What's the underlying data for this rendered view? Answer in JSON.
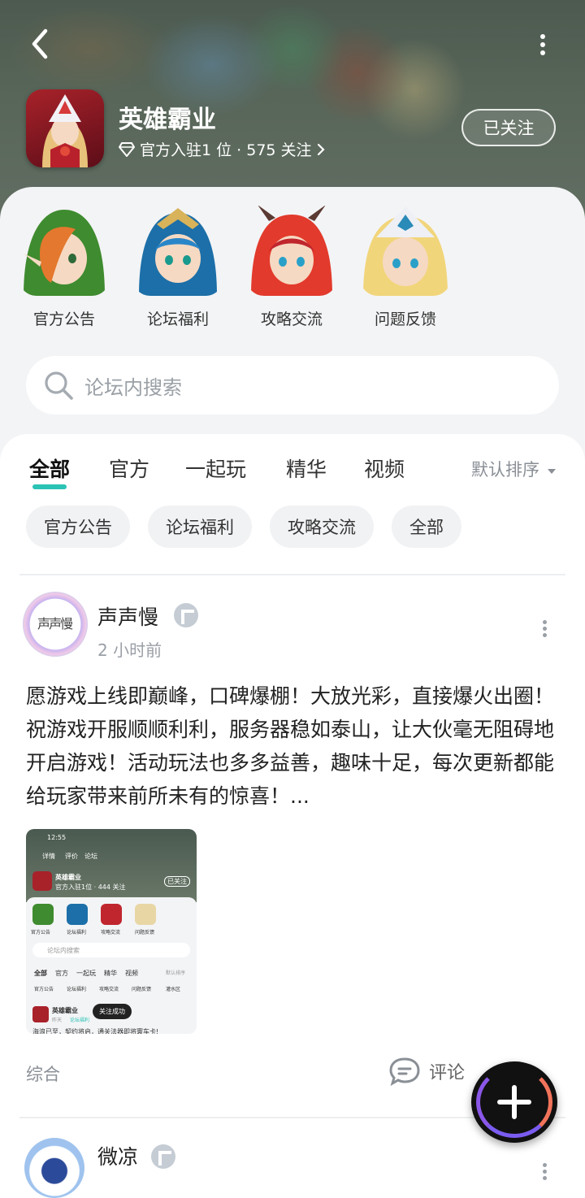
{
  "header": {
    "game_title": "英雄霸业",
    "meta_text": "官方入驻1 位 · 575 关注",
    "follow_label": "已关注"
  },
  "categories": [
    {
      "label": "官方公告",
      "color": "#3f8b2f",
      "hair": "#e4782e"
    },
    {
      "label": "论坛福利",
      "color": "#1c6fa8",
      "hair": "#2a86c8"
    },
    {
      "label": "攻略交流",
      "color": "#c0262e",
      "hair": "#e23a2c"
    },
    {
      "label": "问题反馈",
      "color": "#e8d7a5",
      "hair": "#f1d57a"
    }
  ],
  "search": {
    "placeholder": "论坛内搜索"
  },
  "tabs": [
    {
      "label": "全部",
      "active": true
    },
    {
      "label": "官方",
      "active": false
    },
    {
      "label": "一起玩",
      "active": false
    },
    {
      "label": "精华",
      "active": false
    },
    {
      "label": "视频",
      "active": false
    }
  ],
  "sort_label": "默认排序",
  "chips": [
    "官方公告",
    "论坛福利",
    "攻略交流",
    "全部"
  ],
  "post": {
    "author": "声声慢",
    "avatar_text": "声声慢",
    "time": "2 小时前",
    "text": "愿游戏上线即巅峰，口碑爆棚！大放光彩，直接爆火出圈！祝游戏开服顺顺利利，服务器稳如泰山，让大伙毫无阻碍地开启游戏！活动玩法也多多益善，趣味十足，每次更新都能给玩家带来前所未有的惊喜！...",
    "category": "综合",
    "comment_label": "评论",
    "thumbnail": {
      "status_time": "12:55",
      "nav": [
        "详情",
        "评价",
        "论坛"
      ],
      "game_title": "英雄霸业",
      "meta": "官方入驻1位 · 444 关注",
      "follow": "已关注",
      "cats": [
        "官方公告",
        "论坛福利",
        "攻略交流",
        "问题反馈"
      ],
      "search": "论坛内搜索",
      "tabs": [
        "全部",
        "官方",
        "一起玩",
        "精华",
        "视频"
      ],
      "sort": "默认排序",
      "chips": [
        "官方公告",
        "论坛福利",
        "攻略交流",
        "问题反馈",
        "灌水区"
      ],
      "poster": "英雄霸业",
      "poster_time": "昨天",
      "poster_tag": "论坛福利",
      "toast": "关注成功",
      "snippet": "海浪已至，契约将启，通关法器即将寰车卡!"
    }
  },
  "post2": {
    "author": "微凉"
  },
  "fab": {
    "icon": "plus-icon"
  }
}
